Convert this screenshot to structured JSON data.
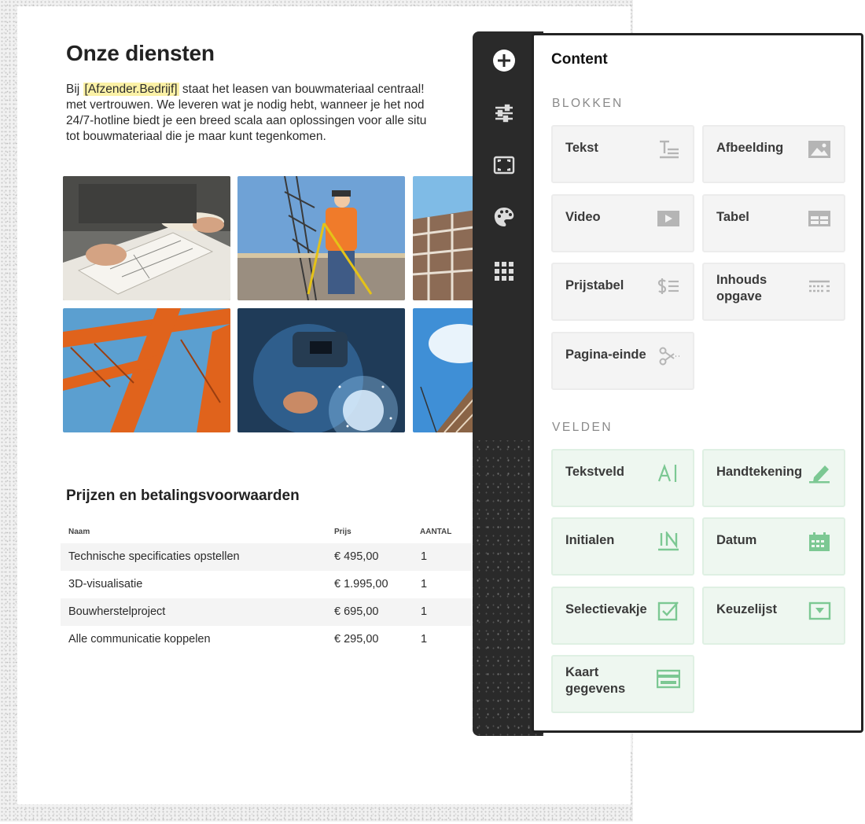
{
  "document": {
    "title": "Onze diensten",
    "intro_lines": [
      {
        "before": "Bij ",
        "highlight": "[Afzender.Bedrijf]",
        "after": " staat het leasen van bouwmateriaal centraal!"
      },
      {
        "text": "met vertrouwen. We leveren wat je nodig hebt, wanneer je het nod"
      },
      {
        "text": "24/7-hotline biedt je een breed scala aan oplossingen voor alle situ"
      },
      {
        "text": "tot bouwmateriaal die je maar kunt tegenkomen."
      }
    ],
    "section_title": "Prijzen en betalingsvoorwaarden",
    "table": {
      "headers": [
        "Naam",
        "Prijs",
        "AANTAL"
      ],
      "rows": [
        [
          "Technische specificaties opstellen",
          "€ 495,00",
          "1"
        ],
        [
          "3D-visualisatie",
          "€ 1.995,00",
          "1"
        ],
        [
          "Bouwherstelproject",
          "€ 695,00",
          "1"
        ],
        [
          "Alle communicatie koppelen",
          "€ 295,00",
          "1"
        ]
      ]
    }
  },
  "sidebar_icons": [
    "add-icon",
    "sliders-icon",
    "frame-icon",
    "palette-icon",
    "grid-icon"
  ],
  "panel": {
    "title": "Content",
    "blocks_label": "BLOKKEN",
    "blocks": [
      {
        "label": "Tekst",
        "icon": "text-icon"
      },
      {
        "label": "Afbeelding",
        "icon": "image-icon"
      },
      {
        "label": "Video",
        "icon": "video-icon"
      },
      {
        "label": "Tabel",
        "icon": "table-icon"
      },
      {
        "label": "Prijstabel",
        "icon": "price-table-icon"
      },
      {
        "label": "Inhouds\nopgave",
        "icon": "toc-icon"
      },
      {
        "label": "Pagina-einde",
        "icon": "scissors-icon"
      }
    ],
    "fields_label": "VELDEN",
    "fields": [
      {
        "label": "Tekstveld",
        "icon": "text-field-icon"
      },
      {
        "label": "Handtekening",
        "icon": "signature-icon"
      },
      {
        "label": "Initialen",
        "icon": "initials-icon"
      },
      {
        "label": "Datum",
        "icon": "calendar-icon"
      },
      {
        "label": "Selectievakje",
        "icon": "checkbox-icon"
      },
      {
        "label": "Keuzelijst",
        "icon": "dropdown-icon"
      },
      {
        "label": "Kaart\ngegevens",
        "icon": "card-icon"
      }
    ]
  },
  "colors": {
    "highlight": "#fbf1a6",
    "rail": "#2a2a2a",
    "field_green": "#7cc893",
    "block_icon_gray": "#b5b5b5"
  }
}
